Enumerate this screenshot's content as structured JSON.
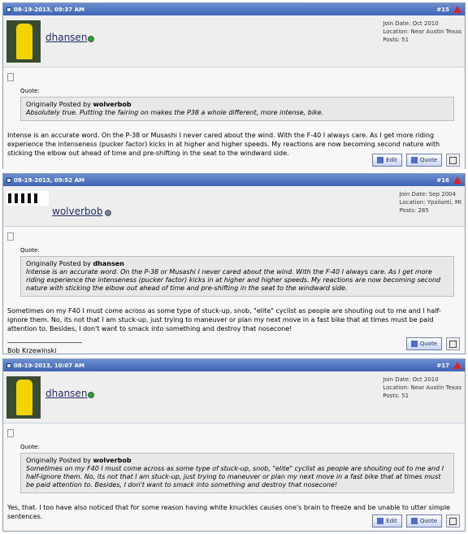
{
  "posts": [
    {
      "date": "08-19-2013, 09:37 AM",
      "number": "#15",
      "username": "dhansen",
      "status_color": "#22a52a",
      "join_date": "Join Date: Oct 2010",
      "location": "Location: Near Austin Texas",
      "posts": "Posts: 51",
      "quote_label": "Quote:",
      "quote_prefix": "Originally Posted by",
      "quote_author": "wolverbob",
      "quote_text": "Absolutely true. Putting the fairing on makes the P38 a whole different, more intense, bike.",
      "message": "Intense is an accurate word. On the P-38 or Musashi I never cared about the wind. With the F-40 I always care. As I get more riding experience the intenseness (pucker factor) kicks in at higher and higher speeds. My reactions are now becoming second nature with sticking the elbow out ahead of time and pre-shifting in the seat to the windward side.",
      "buttons": {
        "edit": "Edit",
        "quote": "Quote"
      }
    },
    {
      "date": "08-19-2013, 09:52 AM",
      "number": "#16",
      "username": "wolverbob",
      "status_color": "#6f7fa8",
      "join_date": "Join Date: Sep 2004",
      "location": "Location: Ypsilanti, MI",
      "posts": "Posts: 285",
      "quote_label": "Quote:",
      "quote_prefix": "Originally Posted by",
      "quote_author": "dhansen",
      "quote_text": "Intense is an accurate word. On the P-38 or Musashi I never cared about the wind. With the F-40 I always care. As I get more riding experience the intenseness (pucker factor) kicks in at higher and higher speeds. My reactions are now becoming second nature with sticking the elbow out ahead of time and pre-shifting in the seat to the windward side.",
      "message": "Sometimes on my F40 I must come across as some type of stuck-up, snob, \"elite\" cyclist as people are shouting out to me and I half-ignore them. No, its not that I am stuck-up, just trying to maneuver or plan my next move in a fast bike that at times must be paid attention to. Besides, I don't want to smack into something and destroy that nosecone!",
      "signature": "Bob Krzewinski",
      "buttons": {
        "quote": "Quote"
      }
    },
    {
      "date": "08-19-2013, 10:07 AM",
      "number": "#17",
      "username": "dhansen",
      "status_color": "#22a52a",
      "join_date": "Join Date: Oct 2010",
      "location": "Location: Near Austin Texas",
      "posts": "Posts: 51",
      "quote_label": "Quote:",
      "quote_prefix": "Originally Posted by",
      "quote_author": "wolverbob",
      "quote_text": "Sometimes on my F40 I must come across as some type of stuck-up, snob, \"elite\" cyclist as people are shouting out to me and I half-ignore them. No, its not that I am stuck-up, just trying to maneuver or plan my next move in a fast bike that at times must be paid attention to. Besides, I don't want to smack into something and destroy that nosecone!",
      "message": "Yes, that. I too have also noticed that for some reason having white knuckles causes one's brain to freeze and be unable to utter simple sentences.",
      "buttons": {
        "edit": "Edit",
        "quote": "Quote"
      }
    }
  ]
}
